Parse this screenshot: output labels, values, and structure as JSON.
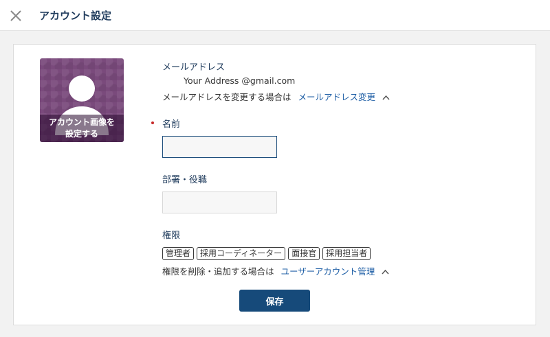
{
  "header": {
    "title": "アカウント設定"
  },
  "avatar": {
    "label_line1": "アカウント画像を",
    "label_line2": "設定する"
  },
  "email": {
    "label": "メールアドレス",
    "value": "Your Address @gmail.com",
    "change_prefix": "メールアドレスを変更する場合は",
    "change_link": "メールアドレス変更"
  },
  "name": {
    "label": "名前",
    "value": ""
  },
  "department": {
    "label": "部署・役職",
    "value": ""
  },
  "permissions": {
    "label": "権限",
    "tags": [
      "管理者",
      "採用コーディネーター",
      "面接官",
      "採用担当者"
    ],
    "change_prefix": "権限を削除・追加する場合は",
    "change_link": "ユーザーアカウント管理"
  },
  "save_label": "保存",
  "colors": {
    "primary": "#164a7a",
    "link": "#1f5fa6",
    "required": "#c62828",
    "avatar_bg": "#7a4a7c"
  }
}
